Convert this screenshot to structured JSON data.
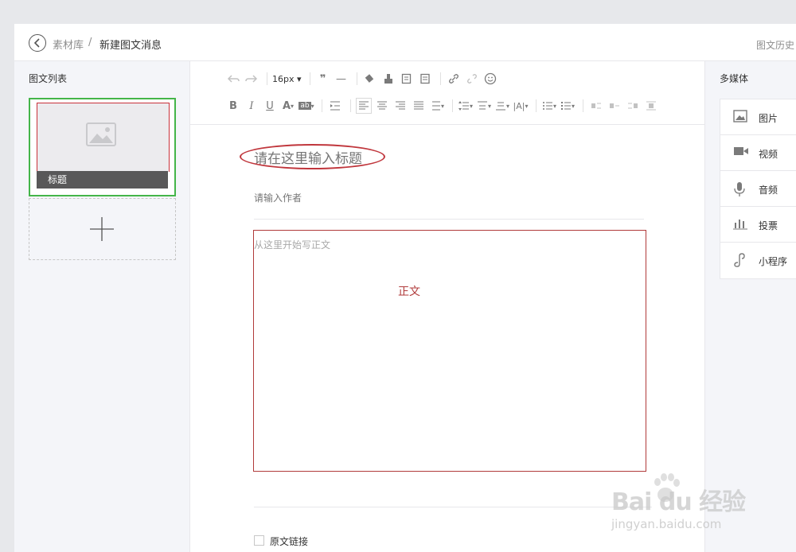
{
  "breadcrumb": {
    "library": "素材库",
    "separator": "/",
    "current": "新建图文消息"
  },
  "header": {
    "history_link": "图文历史"
  },
  "left": {
    "title": "图文列表",
    "card_title": "标题"
  },
  "toolbar": {
    "font_size": "16px"
  },
  "editor": {
    "title_placeholder": "请在这里输入标题",
    "author_placeholder": "请输入作者",
    "body_placeholder": "从这里开始写正文",
    "body_annotation": "正文",
    "original_link_label": "原文链接"
  },
  "right": {
    "title": "多媒体",
    "items": [
      {
        "label": "图片",
        "icon": "image-icon"
      },
      {
        "label": "视频",
        "icon": "video-icon"
      },
      {
        "label": "音频",
        "icon": "microphone-icon"
      },
      {
        "label": "投票",
        "icon": "bar-chart-icon"
      },
      {
        "label": "小程序",
        "icon": "link-icon"
      }
    ]
  },
  "watermark": {
    "brand": "Bai du 经验",
    "url": "jingyan.baidu.com"
  },
  "colors": {
    "selected_border": "#44b549",
    "annotation_red": "#c0363c",
    "card_title_bg": "#595859"
  }
}
